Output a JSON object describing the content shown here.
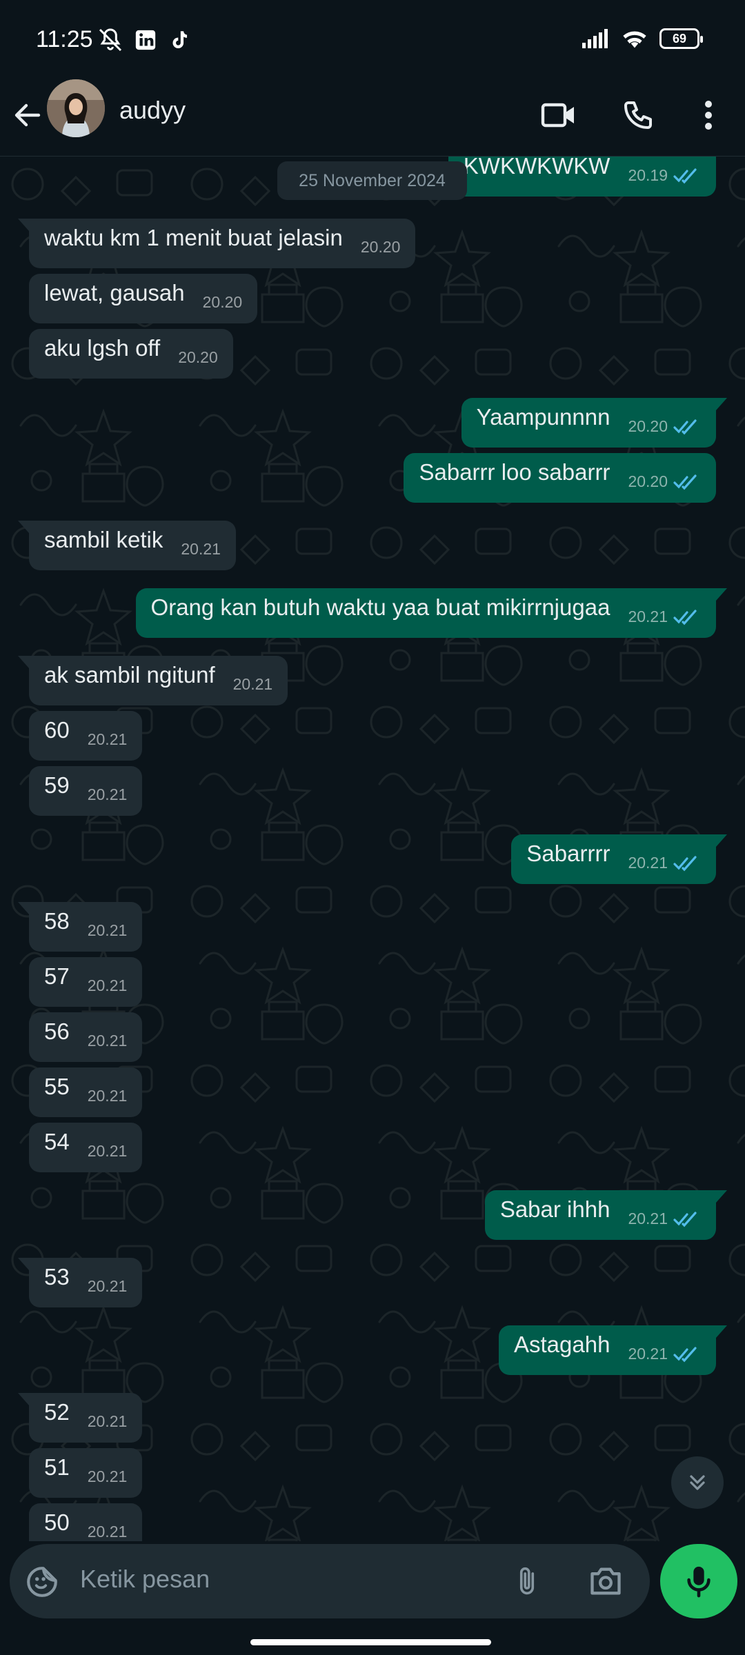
{
  "status_bar": {
    "time": "11:25",
    "battery": "69"
  },
  "header": {
    "contact_name": "audyy"
  },
  "date_chip": "25 November 2024",
  "messages": [
    {
      "dir": "out",
      "text": "KWKWKWKW",
      "time": "20.19",
      "read": true
    },
    {
      "dir": "in",
      "text": "waktu km 1 menit buat jelasin",
      "time": "20.20"
    },
    {
      "dir": "in",
      "text": "lewat, gausah",
      "time": "20.20"
    },
    {
      "dir": "in",
      "text": "aku lgsh off",
      "time": "20.20"
    },
    {
      "dir": "out",
      "text": "Yaampunnnn",
      "time": "20.20",
      "read": true
    },
    {
      "dir": "out",
      "text": "Sabarrr loo sabarrr",
      "time": "20.20",
      "read": true
    },
    {
      "dir": "in",
      "text": "sambil ketik",
      "time": "20.21"
    },
    {
      "dir": "out",
      "text": "Orang kan butuh waktu yaa buat mikirrnjugaa",
      "time": "20.21",
      "read": true
    },
    {
      "dir": "in",
      "text": "ak sambil ngitunf",
      "time": "20.21"
    },
    {
      "dir": "in",
      "text": "60",
      "time": "20.21"
    },
    {
      "dir": "in",
      "text": "59",
      "time": "20.21"
    },
    {
      "dir": "out",
      "text": "Sabarrrr",
      "time": "20.21",
      "read": true
    },
    {
      "dir": "in",
      "text": "58",
      "time": "20.21"
    },
    {
      "dir": "in",
      "text": "57",
      "time": "20.21"
    },
    {
      "dir": "in",
      "text": "56",
      "time": "20.21"
    },
    {
      "dir": "in",
      "text": "55",
      "time": "20.21"
    },
    {
      "dir": "in",
      "text": "54",
      "time": "20.21"
    },
    {
      "dir": "out",
      "text": "Sabar ihhh",
      "time": "20.21",
      "read": true
    },
    {
      "dir": "in",
      "text": "53",
      "time": "20.21"
    },
    {
      "dir": "out",
      "text": "Astagahh",
      "time": "20.21",
      "read": true
    },
    {
      "dir": "in",
      "text": "52",
      "time": "20.21"
    },
    {
      "dir": "in",
      "text": "51",
      "time": "20.21"
    },
    {
      "dir": "in",
      "text": "50",
      "time": "20.21"
    }
  ],
  "composer": {
    "placeholder": "Ketik pesan"
  },
  "icons": {
    "status": [
      "mute-icon",
      "linkedin-icon",
      "tiktok-icon",
      "signal-icon",
      "wifi-icon",
      "battery-icon"
    ],
    "header": [
      "back-arrow-icon",
      "video-call-icon",
      "voice-call-icon",
      "more-options-icon"
    ],
    "composer": [
      "emoji-sticker-icon",
      "attach-icon",
      "camera-icon",
      "mic-icon"
    ],
    "chat": [
      "scroll-down-icon",
      "read-ticks-icon"
    ]
  },
  "colors": {
    "background": "#0b141a",
    "incoming_bubble": "#202c33",
    "outgoing_bubble": "#005c4b",
    "read_ticks": "#53bdeb",
    "mic_button": "#21c063"
  }
}
